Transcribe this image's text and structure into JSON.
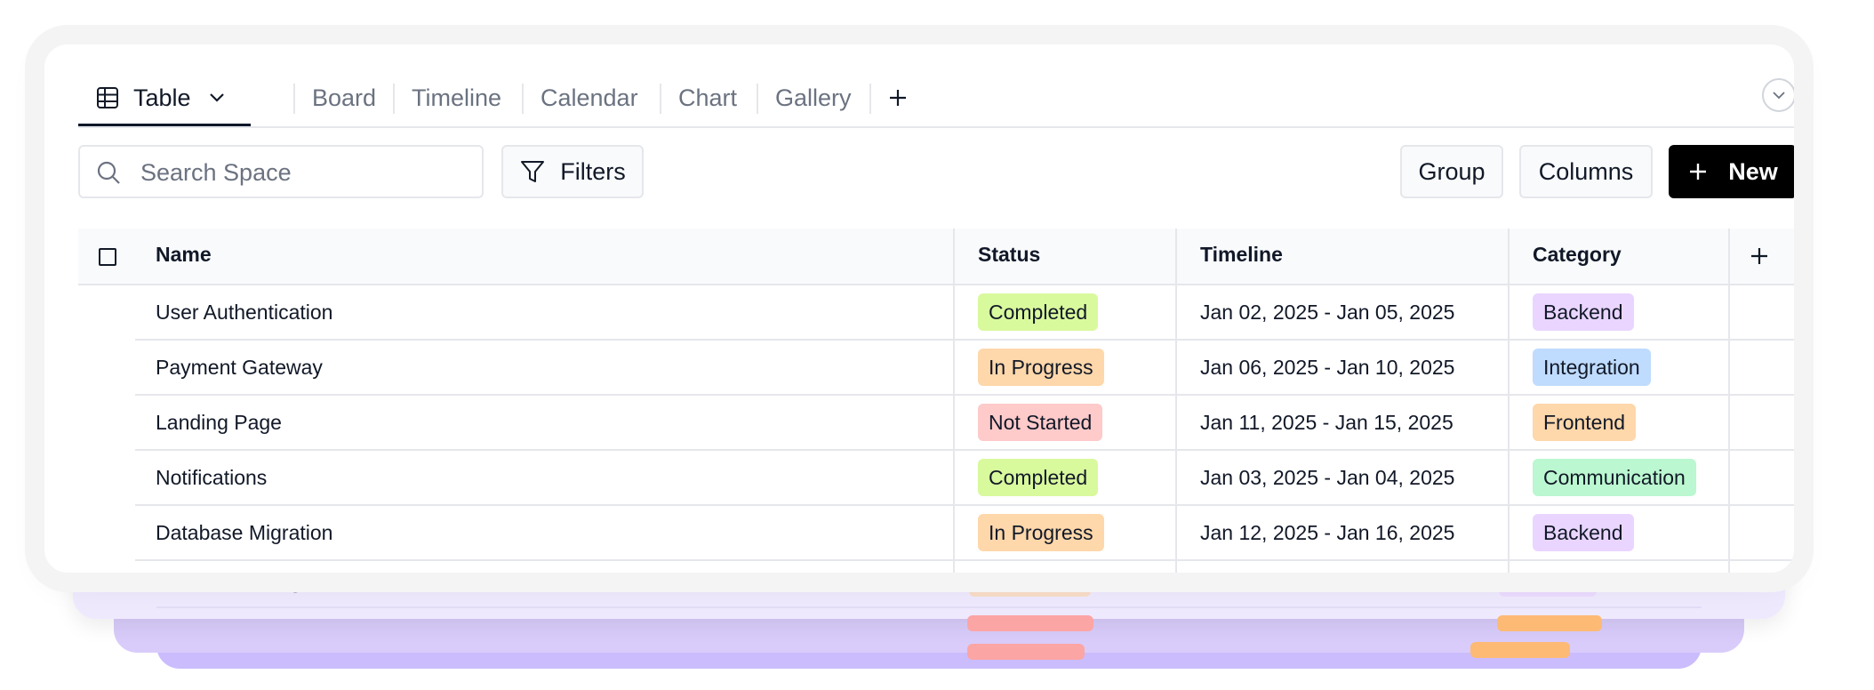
{
  "tabs": [
    {
      "label": "Table",
      "active": true
    },
    {
      "label": "Board"
    },
    {
      "label": "Timeline"
    },
    {
      "label": "Calendar"
    },
    {
      "label": "Chart"
    },
    {
      "label": "Gallery"
    }
  ],
  "toolbar": {
    "search_placeholder": "Search Space",
    "filters_label": "Filters",
    "group_label": "Group",
    "columns_label": "Columns",
    "new_label": "New"
  },
  "table": {
    "headers": [
      "Name",
      "Status",
      "Timeline",
      "Category"
    ],
    "rows": [
      {
        "name": "User Authentication",
        "status": "Completed",
        "timeline": "Jan 02, 2025 - Jan 05, 2025",
        "category": "Backend"
      },
      {
        "name": "Payment Gateway",
        "status": "In Progress",
        "timeline": "Jan 06, 2025 - Jan 10, 2025",
        "category": "Integration"
      },
      {
        "name": "Landing Page",
        "status": "Not Started",
        "timeline": "Jan 11, 2025 - Jan 15, 2025",
        "category": "Frontend"
      },
      {
        "name": "Notifications",
        "status": "Completed",
        "timeline": "Jan 03, 2025 - Jan 04, 2025",
        "category": "Communication"
      },
      {
        "name": "Database Migration",
        "status": "In Progress",
        "timeline": "Jan 12, 2025 - Jan 16, 2025",
        "category": "Backend"
      }
    ]
  },
  "ghost_row": {
    "name": "Database Migration",
    "status": "In Progress",
    "timeline": "Jan 12, 2025 - Jan 16, 2025",
    "category": "Backend"
  },
  "colors": {
    "status_completed": "#d9f99d",
    "status_in_progress": "#fed7aa",
    "status_not_started": "#fecaca",
    "cat_backend": "#e9d5ff",
    "cat_integration": "#bfdbfe",
    "cat_frontend": "#fed7aa",
    "cat_communication": "#bbf7d0",
    "accent": "#000000"
  }
}
